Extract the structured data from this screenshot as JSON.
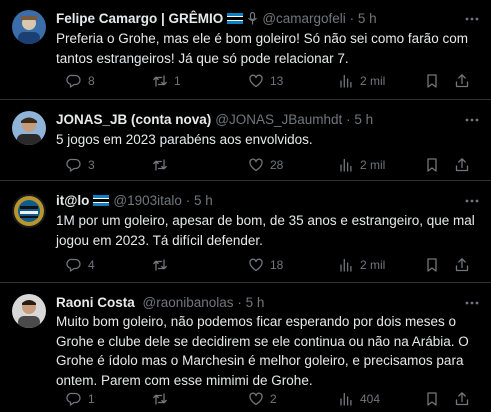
{
  "tweets": [
    {
      "name": "Felipe Camargo | GRÊMIO",
      "handle": "@camargofeli",
      "time": "5 h",
      "text": "Preferia o Grohe, mas ele é bom goleiro! Só não sei como farão com tantos estrangeiros! Já que só pode relacionar 7.",
      "replies": "8",
      "retweets": "1",
      "likes": "13",
      "views": "2 mil"
    },
    {
      "name": "JONAS_JB (conta nova)",
      "handle": "@JONAS_JBaumhdt",
      "time": "5 h",
      "text": "5 jogos em 2023 parabéns aos envolvidos.",
      "replies": "3",
      "retweets": "",
      "likes": "28",
      "views": "2 mil"
    },
    {
      "name": "it@lo",
      "handle": "@1903italo",
      "time": "5 h",
      "text": "1M por um goleiro, apesar de bom, de 35 anos e estrangeiro, que mal jogou em 2023. Tá difícil defender.",
      "replies": "4",
      "retweets": "",
      "likes": "18",
      "views": "2 mil"
    },
    {
      "name": "Raoni Costa",
      "handle": "@raonibanolas",
      "time": "5 h",
      "text": "Muito bom goleiro, não podemos ficar esperando por dois meses o Grohe e clube dele se decidirem se ele continua ou não na Arábia. O Grohe é ídolo mas o Marchesin é melhor goleiro, e precisamos para ontem. Parem com esse mimimi de Grohe.",
      "replies": "1",
      "retweets": "",
      "likes": "2",
      "views": "404"
    }
  ],
  "separator": "·",
  "colors": {
    "background": "#000000",
    "text": "#e7e9ea",
    "muted": "#71767b",
    "divider": "#2f3336"
  }
}
